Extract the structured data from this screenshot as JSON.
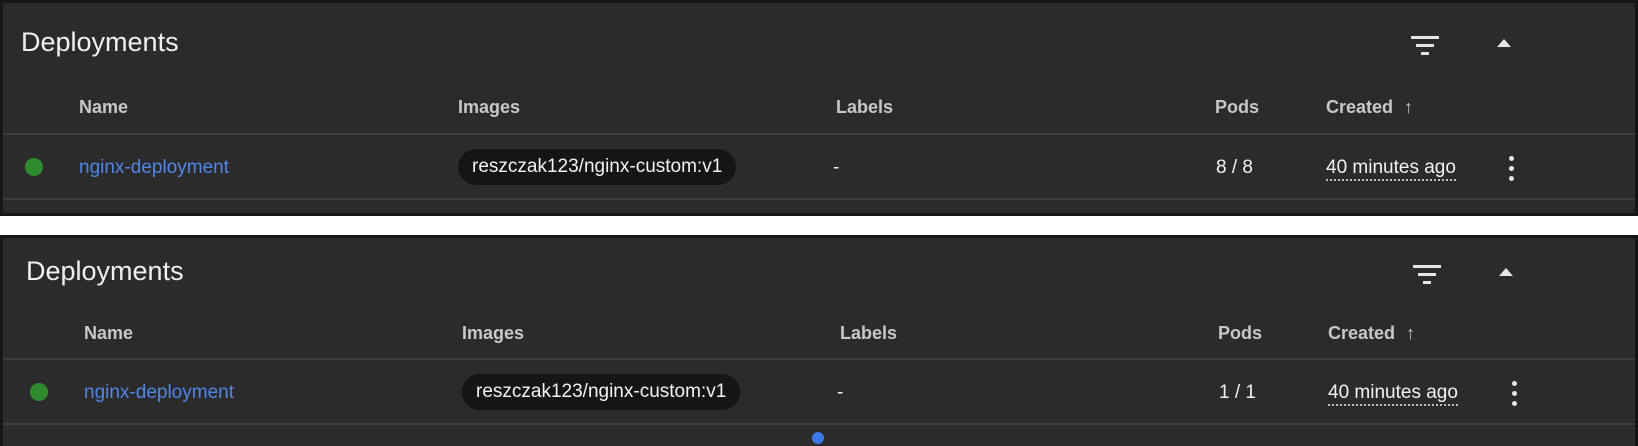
{
  "panels": [
    {
      "title": "Deployments",
      "headers": {
        "name": "Name",
        "images": "Images",
        "labels": "Labels",
        "pods": "Pods",
        "created": "Created",
        "sort_arrow": "↑"
      },
      "row": {
        "status_color": "#2e8b2e",
        "name": "nginx-deployment",
        "image": "reszczak123/nginx-custom:v1",
        "labels": "-",
        "pods": "8 / 8",
        "created": "40 minutes ago"
      }
    },
    {
      "title": "Deployments",
      "headers": {
        "name": "Name",
        "images": "Images",
        "labels": "Labels",
        "pods": "Pods",
        "created": "Created",
        "sort_arrow": "↑"
      },
      "row": {
        "status_color": "#2e8b2e",
        "name": "nginx-deployment",
        "image": "reszczak123/nginx-custom:v1",
        "labels": "-",
        "pods": "1 / 1",
        "created": "40 minutes ago"
      }
    }
  ],
  "icons": {
    "filter": "filter-icon",
    "collapse": "chevron-up-icon",
    "menu": "more-vert-icon"
  },
  "colors": {
    "panel_bg": "#2b2b2b",
    "link": "#4f86e8",
    "status_ok": "#2e8b2e",
    "chip_bg": "#151515"
  }
}
